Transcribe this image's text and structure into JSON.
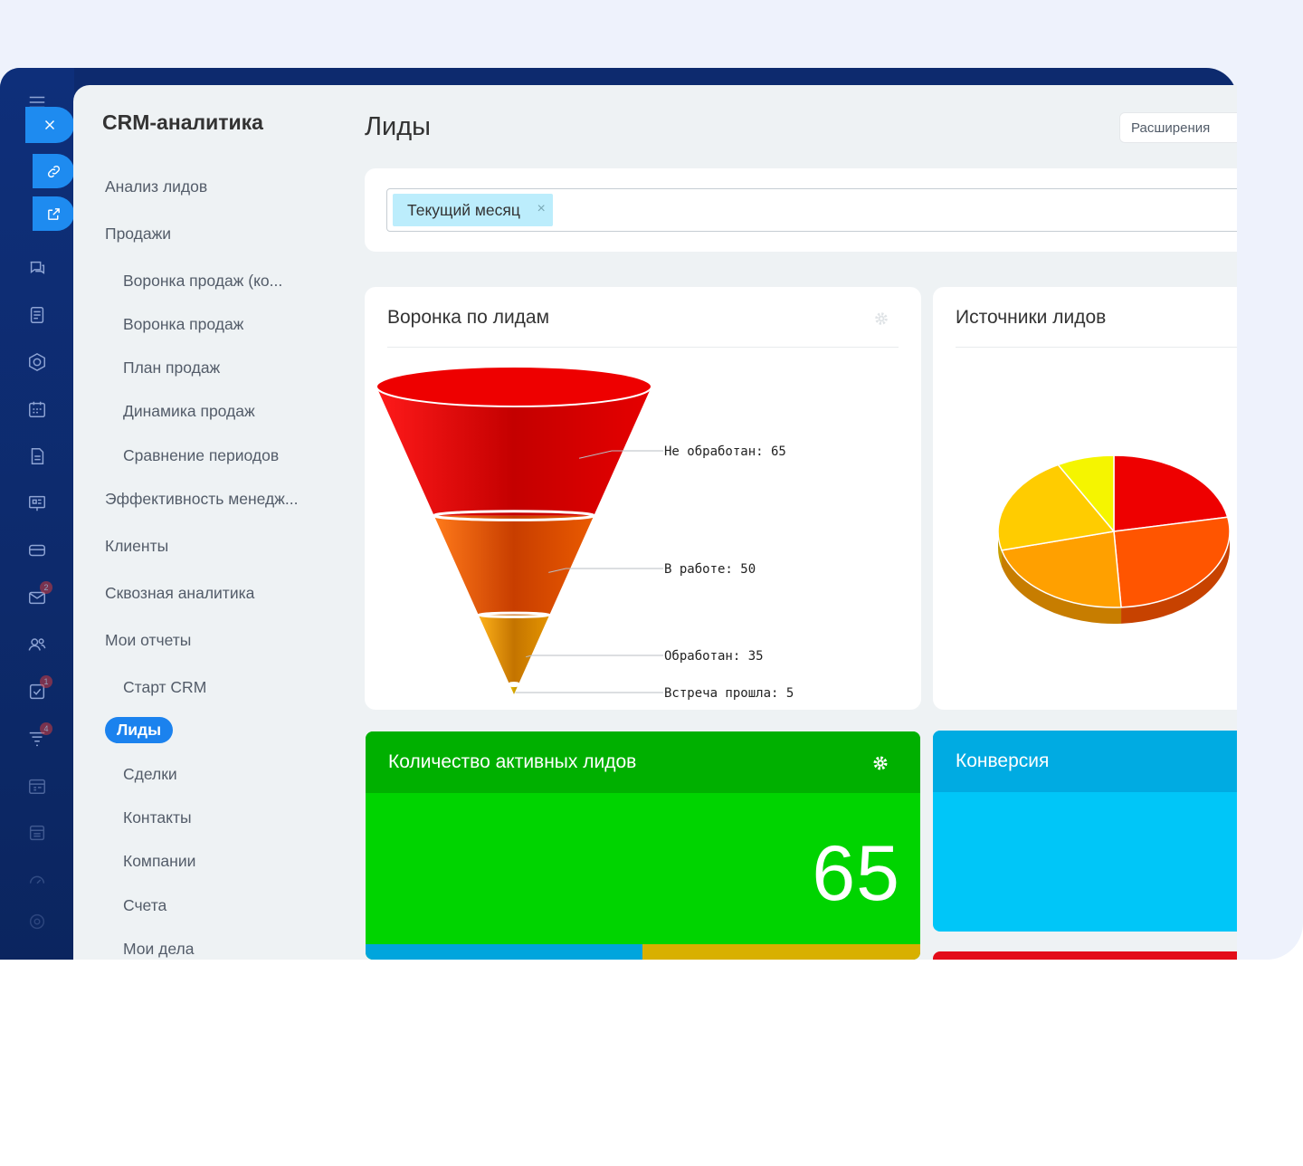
{
  "sidebar": {
    "title": "CRM-аналитика",
    "items": [
      {
        "label": "Анализ лидов"
      },
      {
        "label": "Продажи"
      },
      {
        "label": "Воронка продаж (ко..."
      },
      {
        "label": "Воронка продаж"
      },
      {
        "label": "План продаж"
      },
      {
        "label": "Динамика продаж"
      },
      {
        "label": "Сравнение периодов"
      },
      {
        "label": "Эффективность менедж..."
      },
      {
        "label": "Клиенты"
      },
      {
        "label": "Сквозная аналитика"
      },
      {
        "label": "Мои отчеты"
      },
      {
        "label": "Старт CRM"
      },
      {
        "label": "Лиды"
      },
      {
        "label": "Сделки"
      },
      {
        "label": "Контакты"
      },
      {
        "label": "Компании"
      },
      {
        "label": "Счета"
      },
      {
        "label": "Мои дела"
      }
    ]
  },
  "rail": {
    "badges": [
      "2",
      "1",
      "4"
    ]
  },
  "header": {
    "title": "Лиды",
    "extensions_label": "Расширения"
  },
  "filter": {
    "chip_label": "Текущий месяц",
    "chip_remove": "×"
  },
  "funnel_card": {
    "title": "Воронка по лидам"
  },
  "sources_card": {
    "title": "Источники лидов"
  },
  "active_leads": {
    "title": "Количество активных лидов",
    "value": "65"
  },
  "conversion": {
    "title": "Конверсия"
  },
  "colors": {
    "accent": "#1b82ee",
    "green_tile": "#00d400",
    "green_head": "#00b300",
    "blue_tile": "#00c6f8",
    "blue_head": "#00abe3"
  },
  "chart_data": [
    {
      "type": "funnel",
      "title": "Воронка по лидам",
      "categories": [
        "Не обработан",
        "В работе",
        "Обработан",
        "Встреча прошла"
      ],
      "values": [
        65,
        50,
        35,
        5
      ],
      "labels": [
        "Не обработан: 65",
        "В работе: 50",
        "Обработан: 35",
        "Встреча прошла: 5"
      ],
      "colors": [
        "#e30000",
        "#d24a00",
        "#d98a00",
        "#c8a000"
      ]
    },
    {
      "type": "pie",
      "title": "Источники лидов",
      "values": [
        22,
        27,
        22,
        21,
        8
      ],
      "colors": [
        "#ee0000",
        "#ff5500",
        "#ffa000",
        "#ffcc00",
        "#f5f500"
      ]
    }
  ]
}
